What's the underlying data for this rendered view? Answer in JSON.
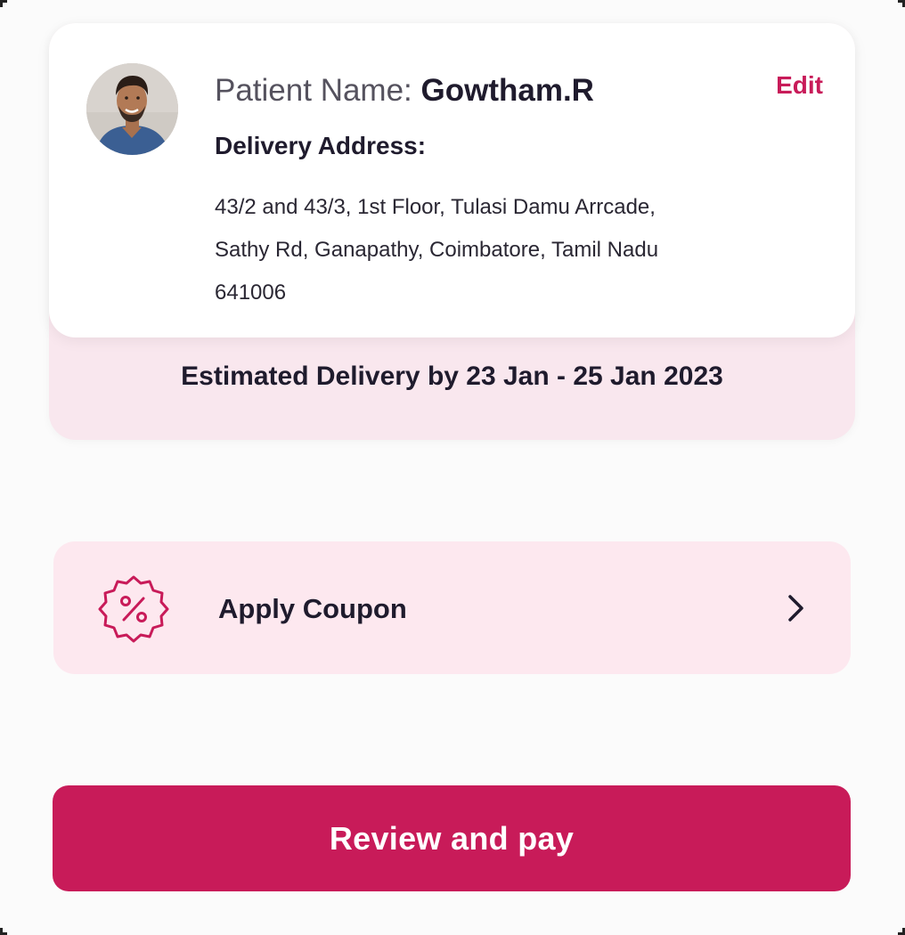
{
  "patient": {
    "label": "Patient Name: ",
    "name": "Gowtham.R",
    "edit_label": "Edit"
  },
  "address": {
    "title": "Delivery Address:",
    "lines": [
      "43/2 and 43/3, 1st Floor, Tulasi Damu Arrcade,",
      "Sathy Rd, Ganapathy, Coimbatore, Tamil Nadu",
      "641006"
    ]
  },
  "delivery": {
    "estimate": "Estimated Delivery by 23 Jan - 25 Jan 2023"
  },
  "coupon": {
    "label": "Apply Coupon",
    "icon": "discount-badge-icon"
  },
  "payment": {
    "button_label": "Review and pay"
  },
  "colors": {
    "accent": "#c81b59",
    "card_pink": "#f9e7ee",
    "coupon_pink": "#fde8ef",
    "background": "#fbfbfb"
  }
}
